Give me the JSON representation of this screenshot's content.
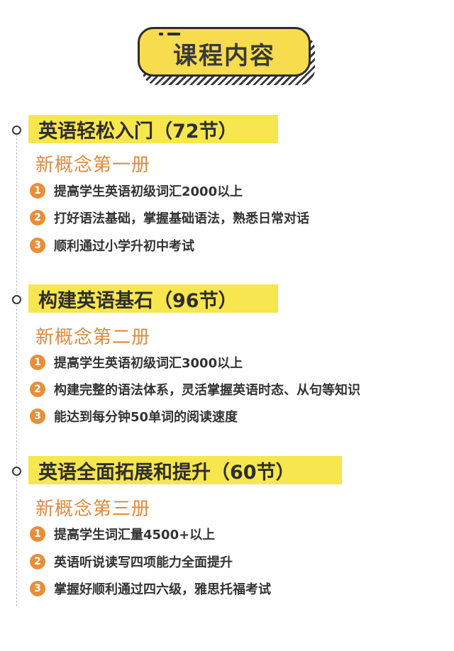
{
  "header": {
    "title": "课程内容"
  },
  "sections": [
    {
      "heading": "英语轻松入门（72节）",
      "book": "新概念第一册",
      "items": [
        {
          "num": "1",
          "text": "提高学生英语初级词汇2000以上"
        },
        {
          "num": "2",
          "text": "打好语法基础，掌握基础语法，熟悉日常对话"
        },
        {
          "num": "3",
          "text": "顺利通过小学升初中考试"
        }
      ]
    },
    {
      "heading": "构建英语基石（96节）",
      "book": "新概念第二册",
      "items": [
        {
          "num": "1",
          "text": "提高学生英语初级词汇3000以上"
        },
        {
          "num": "2",
          "text": "构建完整的语法体系，灵活掌握英语时态、从句等知识"
        },
        {
          "num": "3",
          "text": "能达到每分钟50单词的阅读速度"
        }
      ]
    },
    {
      "heading": "英语全面拓展和提升（60节）",
      "book": "新概念第三册",
      "items": [
        {
          "num": "1",
          "text": "提高学生词汇量4500+以上"
        },
        {
          "num": "2",
          "text": "英语听说读写四项能力全面提升"
        },
        {
          "num": "3",
          "text": "掌握好顺利通过四六级，雅思托福考试"
        }
      ]
    }
  ],
  "colors": {
    "accent_yellow": "#f7e64e",
    "badge_yellow": "#f7dc4e",
    "orange": "#e88e3a",
    "book_orange": "#e08a3c"
  }
}
